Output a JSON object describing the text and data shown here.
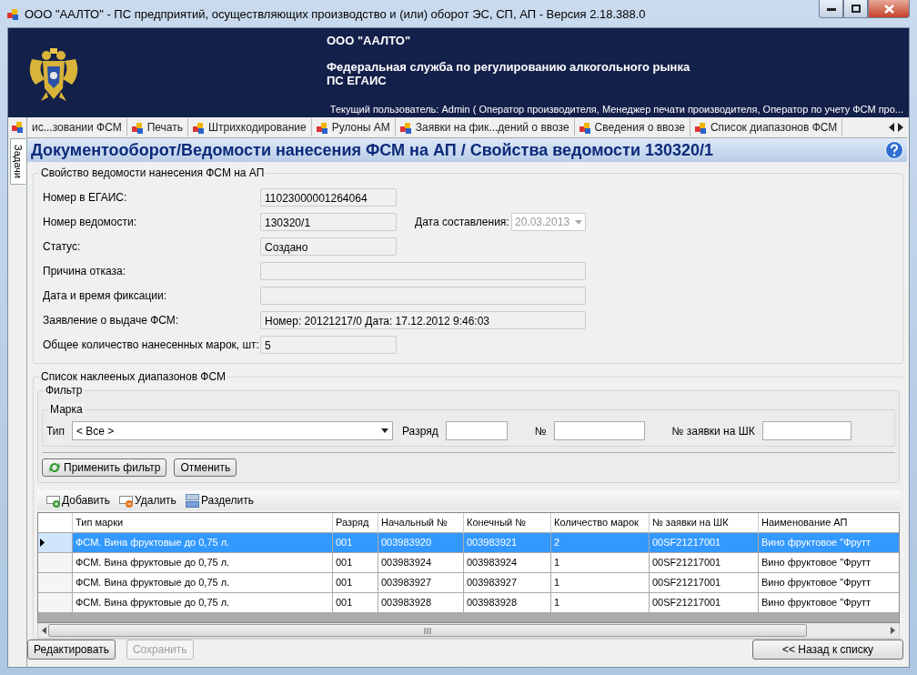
{
  "window": {
    "title": "ООО \"ААЛТО\" - ПС предприятий, осуществляющих производство и (или) оборот ЭС, СП, АП - Версия 2.18.388.0"
  },
  "header": {
    "organization": "ООО \"ААЛТО\"",
    "service": "Федеральная служба по регулированию алкогольного рынка",
    "system": "ПС ЕГАИС",
    "user": "Текущий пользователь: Admin ( Оператор производителя, Менеджер печати производителя, Оператор по учету ФСМ про..."
  },
  "side_tabs": [
    {
      "label": "Задачи",
      "selected": true
    }
  ],
  "tabs": [
    {
      "label": "ис...зовании ФСМ",
      "selected": false
    },
    {
      "label": "Печать",
      "selected": false
    },
    {
      "label": "Штрихкодирование",
      "selected": false
    },
    {
      "label": "Рулоны АМ",
      "selected": false
    },
    {
      "label": "Заявки на фик...дений о ввозе",
      "selected": false
    },
    {
      "label": "Сведения о ввозе",
      "selected": false
    },
    {
      "label": "Список диапазонов ФСМ",
      "selected": false
    }
  ],
  "page_title": "Документооборот/Ведомости нанесения ФСМ на АП / Свойства ведомости 130320/1",
  "properties": {
    "legend": "Свойство ведомости нанесения ФСМ на АП",
    "fields": [
      {
        "label": "Номер в ЕГАИС:",
        "value": "11023000001264064",
        "kind": "short"
      },
      {
        "label": "Номер ведомости:",
        "value": "130320/1",
        "kind": "short",
        "side": {
          "label": "Дата составления:",
          "value": "20.03.2013",
          "disabled": true
        }
      },
      {
        "label": "Статус:",
        "value": "Создано",
        "kind": "short"
      },
      {
        "label": "Причина отказа:",
        "kind": "wide"
      },
      {
        "label": "Дата и время фиксации:",
        "kind": "wide"
      },
      {
        "label": "Заявление о выдаче ФСМ:",
        "value": "Номер: 20121217/0 Дата: 17.12.2012 9:46:03",
        "kind": "wide"
      },
      {
        "label": "Общее количество нанесенных марок, шт:",
        "value": "5",
        "kind": "short"
      }
    ]
  },
  "ranges": {
    "legend": "Список наклееных диапазонов ФСМ",
    "filter": {
      "legend": "Фильтр",
      "group": "Марка",
      "type_label": "Тип",
      "type_value": "< Все >",
      "inputs": [
        {
          "label": "Разряд"
        },
        {
          "label": "№"
        },
        {
          "label": "№ заявки на ШК"
        }
      ]
    },
    "filter_buttons": [
      {
        "label": "Применить фильтр",
        "kind": "apply"
      },
      {
        "label": "Отменить",
        "kind": "plain"
      }
    ],
    "toolbar": [
      {
        "label": "Добавить",
        "kind": "add"
      },
      {
        "label": "Удалить",
        "kind": "remove"
      },
      {
        "label": "Разделить",
        "kind": "split"
      }
    ],
    "table": {
      "columns": [
        "Тип марки",
        "Разряд",
        "Начальный №",
        "Конечный №",
        "Количество марок",
        "№ заявки на ШК",
        "Наименование АП"
      ],
      "rows": [
        {
          "selected": true,
          "cells": [
            "ФСМ. Вина фруктовые до 0,75 л.",
            "001",
            "003983920",
            "003983921",
            "2",
            "00SF21217001",
            "Вино фруктовое \"Фрутт"
          ]
        },
        {
          "selected": false,
          "cells": [
            "ФСМ. Вина фруктовые до 0,75 л.",
            "001",
            "003983924",
            "003983924",
            "1",
            "00SF21217001",
            "Вино фруктовое \"Фрутт"
          ]
        },
        {
          "selected": false,
          "cells": [
            "ФСМ. Вина фруктовые до 0,75 л.",
            "001",
            "003983927",
            "003983927",
            "1",
            "00SF21217001",
            "Вино фруктовое \"Фрутт"
          ]
        },
        {
          "selected": false,
          "cells": [
            "ФСМ. Вина фруктовые до 0,75 л.",
            "001",
            "003983928",
            "003983928",
            "1",
            "00SF21217001",
            "Вино фруктовое \"Фрутт"
          ]
        }
      ]
    }
  },
  "buttons": [
    {
      "label": "Редактировать",
      "kind": "left",
      "disabled": false
    },
    {
      "label": "Сохранить",
      "kind": "left",
      "disabled": true
    },
    {
      "label": "<< Назад к списку",
      "kind": "back",
      "disabled": false
    }
  ]
}
